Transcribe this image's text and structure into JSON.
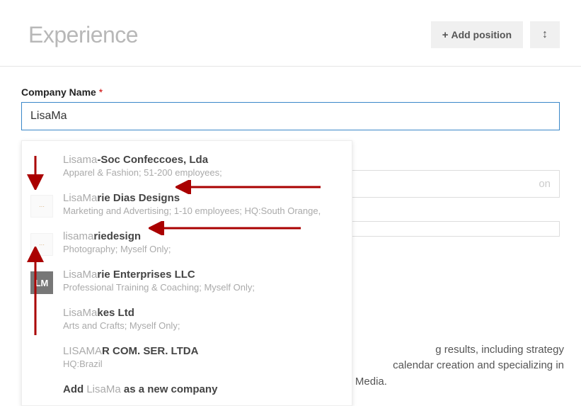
{
  "header": {
    "title": "Experience",
    "add_button": "Add position"
  },
  "form": {
    "label": "Company Name",
    "required_marker": "*",
    "input_value": "LisaMa",
    "hidden_placeholder_1": "on",
    "hidden_placeholder_2": ""
  },
  "suggestions": [
    {
      "logo_type": "empty",
      "logo_text": "",
      "name_match": "Lisama",
      "name_rest": "-Soc Confeccoes, Lda",
      "meta": "Apparel & Fashion; 51-200 employees;"
    },
    {
      "logo_type": "faint",
      "logo_text": "···",
      "name_match": "LisaMa",
      "name_rest": "rie Dias Designs",
      "meta": "Marketing and Advertising; 1-10 employees; HQ:South Orange,"
    },
    {
      "logo_type": "faint",
      "logo_text": "···",
      "name_match": "lisama",
      "name_rest": "riedesign",
      "meta": "Photography; Myself Only;"
    },
    {
      "logo_type": "lm",
      "logo_text": "LM",
      "name_match": "LisaMa",
      "name_rest": "rie Enterprises LLC",
      "meta": "Professional Training & Coaching; Myself Only;"
    },
    {
      "logo_type": "empty",
      "logo_text": "",
      "name_match": "LisaMa",
      "name_rest": "kes Ltd",
      "meta": "Arts and Crafts; Myself Only;"
    },
    {
      "logo_type": "empty",
      "logo_text": "",
      "name_match": "LISAMA",
      "name_rest": "R COM. SER. LTDA",
      "meta": "HQ:Brazil"
    }
  ],
  "add_new": {
    "lead": "Add ",
    "match": "LisaMa",
    "tail": " as a new company"
  },
  "bg_text": {
    "line1": "g results, including strategy",
    "line2": "calendar creation and specializing in",
    "line3": "e-newsletter start-up with Constant Contact and introductions to Social Media."
  }
}
